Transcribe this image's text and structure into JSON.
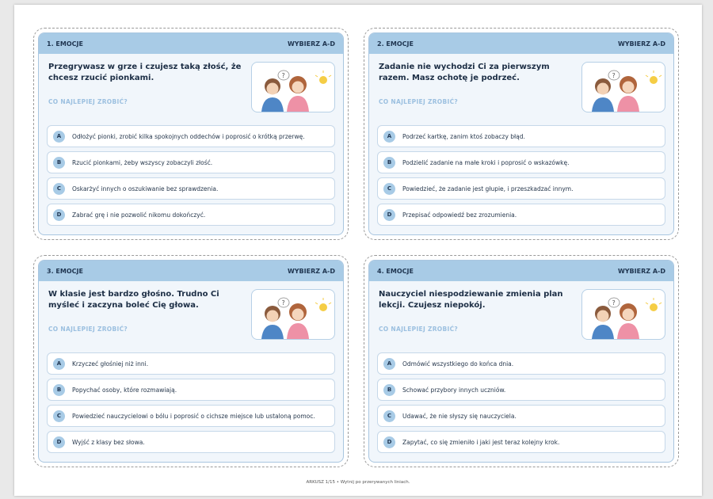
{
  "cards": [
    {
      "label": "1. EMOCJE",
      "instruction": "WYBIERZ A-D",
      "question": "Przegrywasz w grze i czujesz taką złość, że chcesz rzucić pionkami.",
      "hint": "CO NAJLEPIEJ ZROBIĆ?",
      "options": [
        {
          "letter": "A",
          "text": "Odłożyć pionki, zrobić kilka spokojnych oddechów i poprosić o krótką przerwę."
        },
        {
          "letter": "B",
          "text": "Rzucić pionkami, żeby wszyscy zobaczyli złość."
        },
        {
          "letter": "C",
          "text": "Oskarżyć innych o oszukiwanie bez sprawdzenia."
        },
        {
          "letter": "D",
          "text": "Zabrać grę i nie pozwolić nikomu dokończyć."
        }
      ]
    },
    {
      "label": "2. EMOCJE",
      "instruction": "WYBIERZ A-D",
      "question": "Zadanie nie wychodzi Ci za pierwszym razem. Masz ochotę je podrzeć.",
      "hint": "CO NAJLEPIEJ ZROBIĆ?",
      "options": [
        {
          "letter": "A",
          "text": "Podrzeć kartkę, zanim ktoś zobaczy błąd."
        },
        {
          "letter": "B",
          "text": "Podzielić zadanie na małe kroki i poprosić o wskazówkę."
        },
        {
          "letter": "C",
          "text": "Powiedzieć, że zadanie jest głupie, i przeszkadzać innym."
        },
        {
          "letter": "D",
          "text": "Przepisać odpowiedź bez zrozumienia."
        }
      ]
    },
    {
      "label": "3. EMOCJE",
      "instruction": "WYBIERZ A-D",
      "question": "W klasie jest bardzo głośno. Trudno Ci myśleć i zaczyna boleć Cię głowa.",
      "hint": "CO NAJLEPIEJ ZROBIĆ?",
      "options": [
        {
          "letter": "A",
          "text": "Krzyczeć głośniej niż inni."
        },
        {
          "letter": "B",
          "text": "Popychać osoby, które rozmawiają."
        },
        {
          "letter": "C",
          "text": "Powiedzieć nauczycielowi o bólu i poprosić o cichsze miejsce lub ustaloną pomoc."
        },
        {
          "letter": "D",
          "text": "Wyjść z klasy bez słowa."
        }
      ]
    },
    {
      "label": "4. EMOCJE",
      "instruction": "WYBIERZ A-D",
      "question": "Nauczyciel niespodziewanie zmienia plan lekcji. Czujesz niepokój.",
      "hint": "CO NAJLEPIEJ ZROBIĆ?",
      "options": [
        {
          "letter": "A",
          "text": "Odmówić wszystkiego do końca dnia."
        },
        {
          "letter": "B",
          "text": "Schować przybory innych uczniów."
        },
        {
          "letter": "C",
          "text": "Udawać, że nie słyszy się nauczyciela."
        },
        {
          "letter": "D",
          "text": "Zapytać, co się zmieniło i jaki jest teraz kolejny krok."
        }
      ]
    }
  ],
  "footer": "ARKUSZ 1/15  •  Wytnij po przerywanych liniach."
}
